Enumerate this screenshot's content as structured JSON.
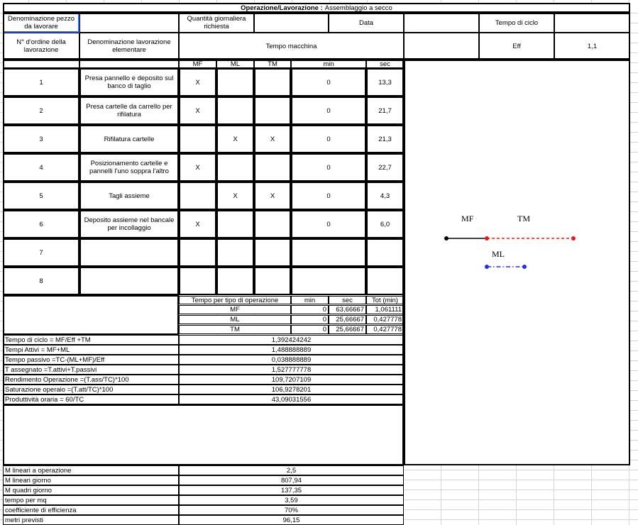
{
  "title": {
    "label": "Operazione/Lavorazione :",
    "value": "Assemblaggio a secco"
  },
  "header": {
    "denominazione_pezzo": "Denominazione pezzo da lavorare",
    "quantita": "Quantità giornaliera richiesta",
    "data": "Data",
    "tempo_ciclo": "Tempo di ciclo",
    "n_ordine": "N° d'ordine della lavorazione",
    "denominazione_lav": "Denominazione lavorazione elementare",
    "tempo_macchina": "Tempo macchina",
    "eff_label": "Eff",
    "eff_value": "1,1"
  },
  "columns": {
    "mf": "MF",
    "ml": "ML",
    "tm": "TM",
    "min": "min",
    "sec": "sec"
  },
  "rows": [
    {
      "n": "1",
      "desc": "Presa pannello e deposito sul banco di taglio",
      "mf": "X",
      "ml": "",
      "tm": "",
      "min": "0",
      "sec": "13,3"
    },
    {
      "n": "2",
      "desc": "Presa cartelle   da carrello per rifilatura",
      "mf": "X",
      "ml": "",
      "tm": "",
      "min": "0",
      "sec": "21,7"
    },
    {
      "n": "3",
      "desc": "Rifilatura cartelle",
      "mf": "",
      "ml": "X",
      "tm": "X",
      "min": "0",
      "sec": "21,3"
    },
    {
      "n": "4",
      "desc": "Posizionamento cartelle e pannelli l'uno soppra  l'altro",
      "mf": "X",
      "ml": "",
      "tm": "",
      "min": "0",
      "sec": "22,7"
    },
    {
      "n": "5",
      "desc": "Tagli assieme",
      "mf": "",
      "ml": "X",
      "tm": "X",
      "min": "0",
      "sec": "4,3"
    },
    {
      "n": "6",
      "desc": "Deposito assieme nel bancale per incollaggio",
      "mf": "X",
      "ml": "",
      "tm": "",
      "min": "0",
      "sec": "6,0"
    },
    {
      "n": "7",
      "desc": "",
      "mf": "",
      "ml": "",
      "tm": "",
      "min": "",
      "sec": ""
    },
    {
      "n": "8",
      "desc": "",
      "mf": "",
      "ml": "",
      "tm": "",
      "min": "",
      "sec": ""
    }
  ],
  "summary": {
    "header": "Tempo per tipo di operazione",
    "min": "min",
    "sec": "sec",
    "tot": "Tot (min)",
    "rows": [
      {
        "label": "MF",
        "min": "0",
        "sec": "63,66667",
        "tot": "1,061111"
      },
      {
        "label": "ML",
        "min": "0",
        "sec": "25,66667",
        "tot": "0,427778"
      },
      {
        "label": "TM",
        "min": "0",
        "sec": "25,66667",
        "tot": "0,427778"
      }
    ]
  },
  "formulas": [
    {
      "label": "Tempo di ciclo = MF/Eff +TM",
      "value": "1,392424242"
    },
    {
      "label": "Tempi Attivi = MF+ML",
      "value": "1,488888889"
    },
    {
      "label": "Tempo passivo =TC-(ML+MF)/Eff",
      "value": "0,038888889"
    },
    {
      "label": "T assegnato =T.attivi+T.passivi",
      "value": "1,527777778"
    },
    {
      "label": "Rendimento Operazione =(T.ass/TC)*100",
      "value": "109,7207109"
    },
    {
      "label": "Saturazione operaio =(T.att/TC)*100",
      "value": "106,9278201"
    },
    {
      "label": "Produttività oraria = 60/TC",
      "value": "43,09031556"
    }
  ],
  "bottom": [
    {
      "label": "M lineari a operazione",
      "value": "2,5"
    },
    {
      "label": "M lineari  giorno",
      "value": "807,94"
    },
    {
      "label": "M quadri  giorno",
      "value": "137,35"
    },
    {
      "label": "tempo per mq",
      "value": "3,59"
    },
    {
      "label": "coefficiente di efficienza",
      "value": "70%"
    },
    {
      "label": "metri previsti",
      "value": "96,15"
    }
  ],
  "diagram": {
    "mf": "MF",
    "tm": "TM",
    "ml": "ML",
    "colors": {
      "mf": "#000000",
      "tm": "#e8191c",
      "ml": "#2b2be0"
    }
  }
}
